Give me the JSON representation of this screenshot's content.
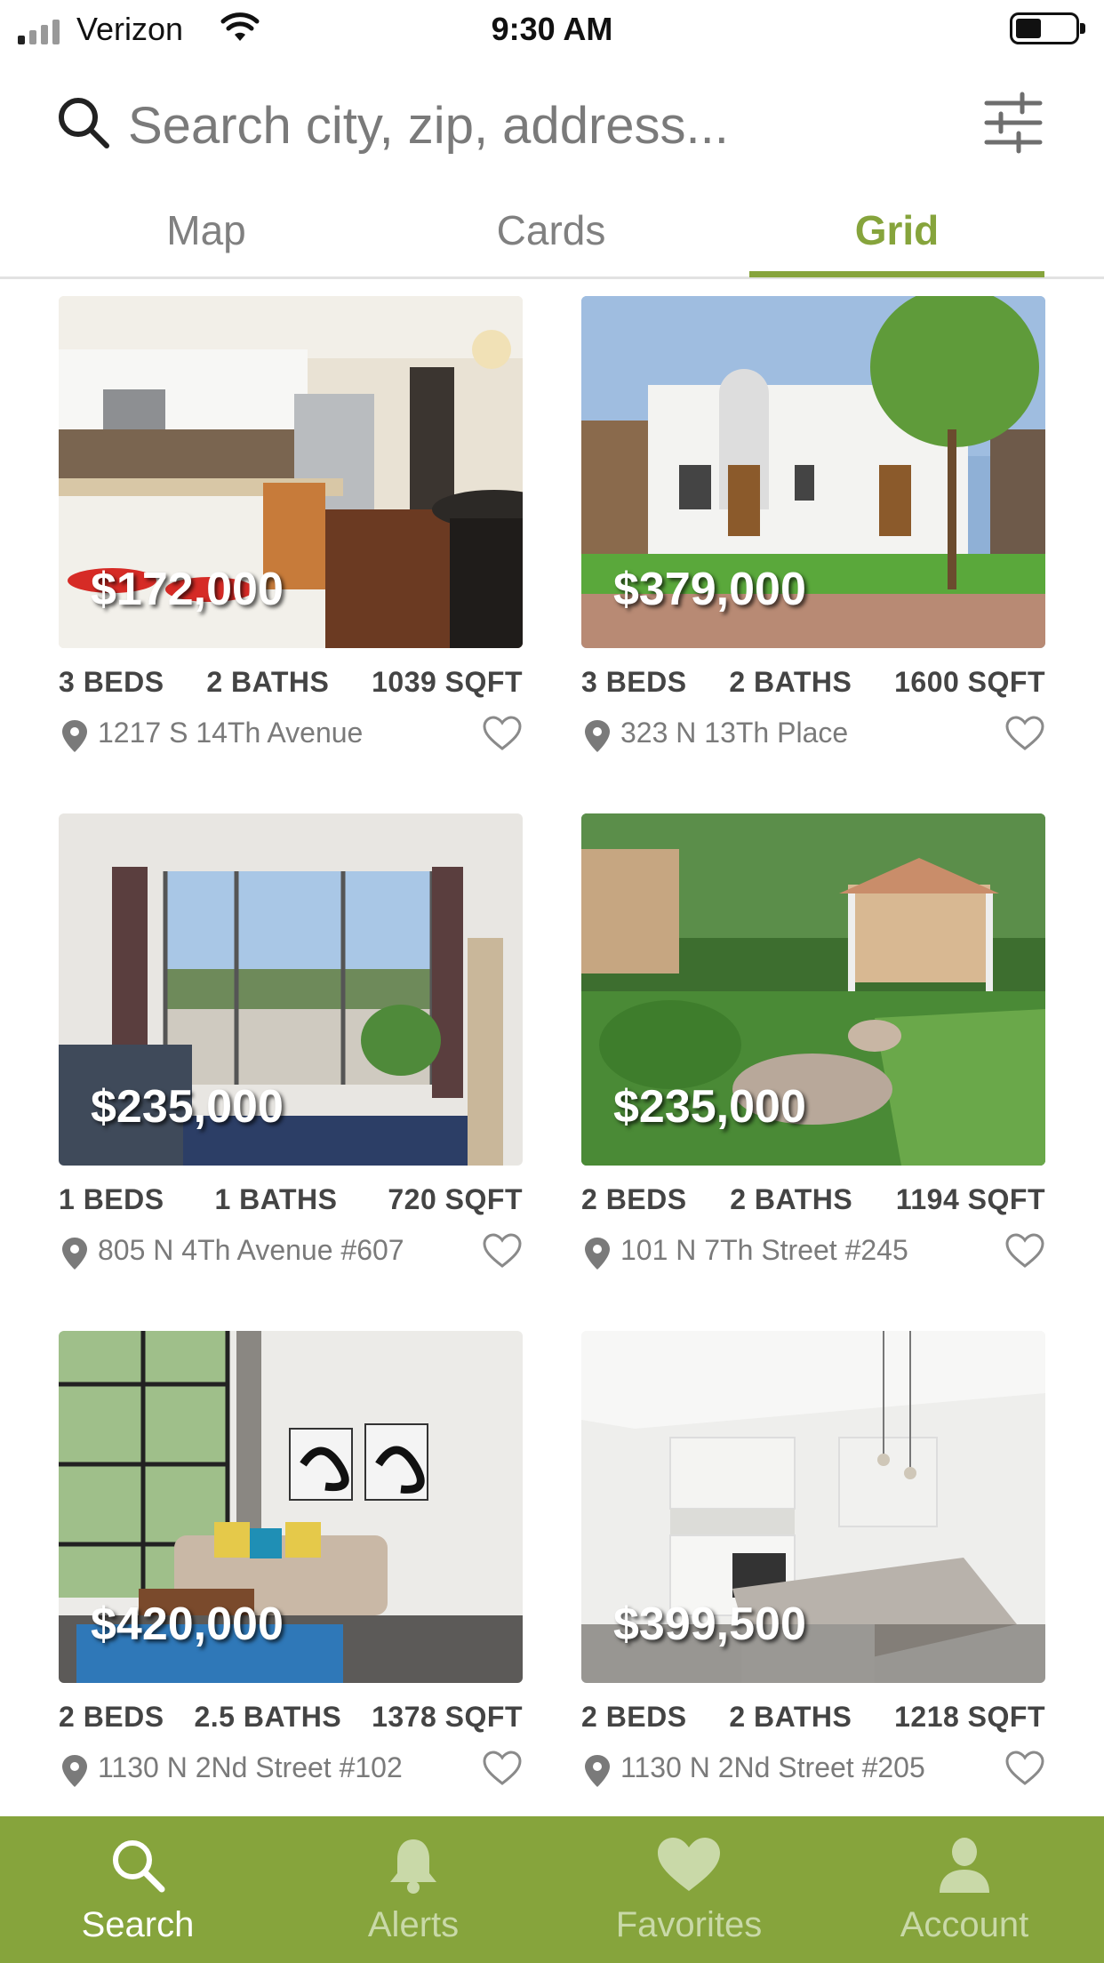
{
  "status_bar": {
    "carrier": "Verizon",
    "time": "9:30 AM",
    "signal_bars": 1,
    "battery_level": 0.35
  },
  "search": {
    "placeholder": "Search city, zip, address...",
    "icon": "search-icon",
    "filter_icon": "sliders-icon"
  },
  "view_tabs": [
    {
      "label": "Map",
      "active": false
    },
    {
      "label": "Cards",
      "active": false
    },
    {
      "label": "Grid",
      "active": true
    }
  ],
  "accent_color": "#86a43c",
  "listings": [
    {
      "price": "$172,000",
      "beds": "3 BEDS",
      "baths": "2 BATHS",
      "sqft": "1039 SQFT",
      "address": "1217 S 14Th Avenue",
      "photo": "kitchen"
    },
    {
      "price": "$379,000",
      "beds": "3 BEDS",
      "baths": "2 BATHS",
      "sqft": "1600 SQFT",
      "address": "323 N 13Th Place",
      "photo": "house-exterior"
    },
    {
      "price": "$235,000",
      "beds": "1 BEDS",
      "baths": "1 BATHS",
      "sqft": "720 SQFT",
      "address": "805 N 4Th Avenue #607",
      "photo": "living-room-balcony"
    },
    {
      "price": "$235,000",
      "beds": "2 BEDS",
      "baths": "2 BATHS",
      "sqft": "1194 SQFT",
      "address": "101 N 7Th Street #245",
      "photo": "garden-gazebo"
    },
    {
      "price": "$420,000",
      "beds": "2 BEDS",
      "baths": "2.5 BATHS",
      "sqft": "1378 SQFT",
      "address": "1130 N 2Nd Street #102",
      "photo": "loft-living-room"
    },
    {
      "price": "$399,500",
      "beds": "2 BEDS",
      "baths": "2 BATHS",
      "sqft": "1218 SQFT",
      "address": "1130 N 2Nd Street #205",
      "photo": "modern-kitchen"
    }
  ],
  "tab_bar": [
    {
      "label": "Search",
      "icon": "search-icon",
      "active": true
    },
    {
      "label": "Alerts",
      "icon": "bell-icon",
      "active": false
    },
    {
      "label": "Favorites",
      "icon": "heart-icon",
      "active": false
    },
    {
      "label": "Account",
      "icon": "user-icon",
      "active": false
    }
  ]
}
